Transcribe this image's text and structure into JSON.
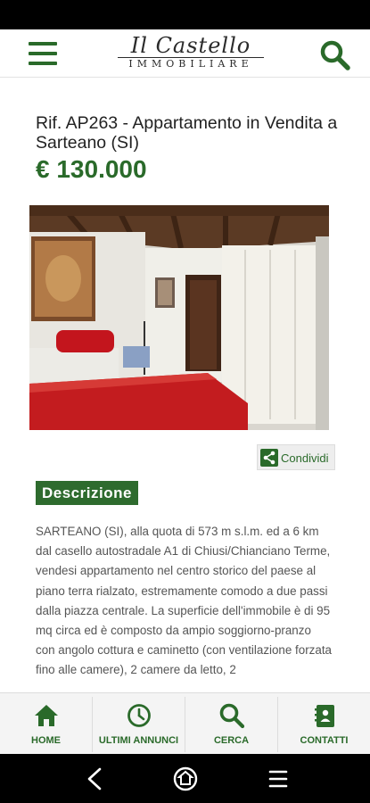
{
  "header": {
    "logo_line1": "Il Castello",
    "logo_line2": "IMMOBILIARE",
    "menu_icon": "hamburger-icon",
    "search_icon": "search-icon"
  },
  "listing": {
    "title": "Rif. AP263 - Appartamento in Vendita a Sarteano (SI)",
    "price": "€ 130.000"
  },
  "share": {
    "label": "Condividi",
    "icon": "share-icon"
  },
  "description": {
    "heading": "Descrizione",
    "text": "SARTEANO (SI), alla quota di 573 m s.l.m. ed a 6 km dal casello autostradale A1 di Chiusi/Chianciano Terme, vendesi appartamento nel centro storico del paese al piano terra rialzato, estremamente comodo a due passi dalla piazza centrale. La superficie dell'immobile è di 95 mq circa ed è composto da ampio soggiorno-pranzo con angolo cottura e caminetto (con ventilazione forzata fino alle camere), 2 camere da letto, 2"
  },
  "tabs": [
    {
      "label": "HOME",
      "icon": "home-icon"
    },
    {
      "label": "ULTIMI ANNUNCI",
      "icon": "clock-icon"
    },
    {
      "label": "CERCA",
      "icon": "search-icon"
    },
    {
      "label": "CONTATTI",
      "icon": "contact-book-icon"
    }
  ],
  "colors": {
    "brand_green": "#2a6a2a",
    "heading_bg": "#2e6b2e"
  }
}
